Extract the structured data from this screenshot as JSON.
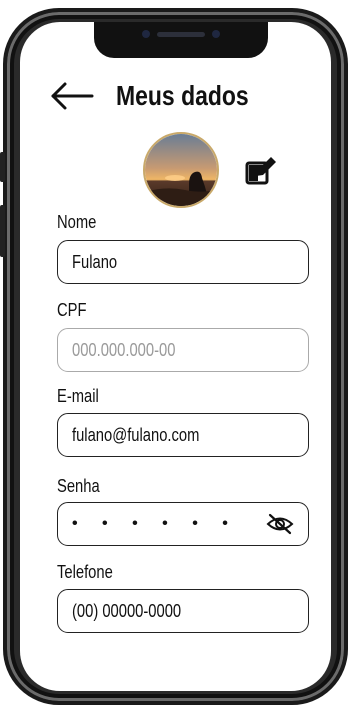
{
  "header": {
    "title": "Meus dados"
  },
  "profile": {
    "avatar_icon": "profile-photo",
    "edit_icon": "edit-icon"
  },
  "fields": {
    "nome": {
      "label": "Nome",
      "value": "Fulano"
    },
    "cpf": {
      "label": "CPF",
      "placeholder": "000.000.000-00"
    },
    "email": {
      "label": "E-mail",
      "value": "fulano@fulano.com"
    },
    "senha": {
      "label": "Senha",
      "value": "• • • • • •",
      "toggle_icon": "eye-off-icon"
    },
    "telefone": {
      "label": "Telefone",
      "value": "(00) 00000-0000"
    }
  },
  "colors": {
    "text": "#111111",
    "border": "#222222",
    "disabled_border": "#aaaaaa",
    "placeholder": "#9a9a9a",
    "avatar_ring": "#c9a96a"
  }
}
